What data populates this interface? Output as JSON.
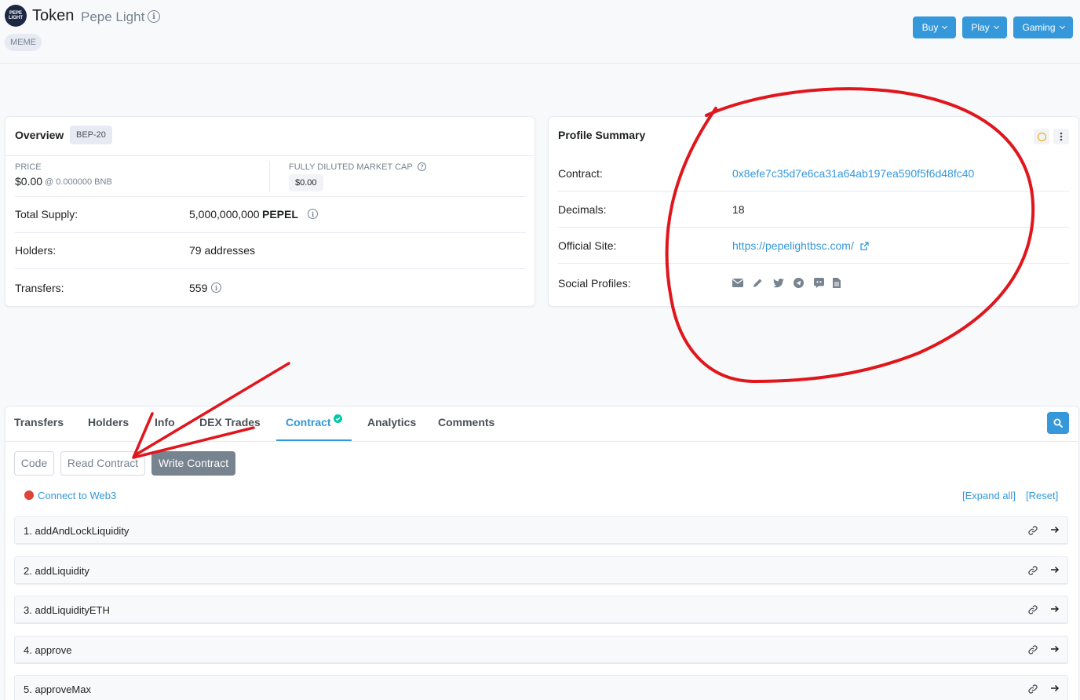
{
  "header": {
    "logo_text": "PEPE LIGHT",
    "title": "Token",
    "token_name": "Pepe Light",
    "tag": "MEME",
    "buttons": [
      {
        "label": "Buy"
      },
      {
        "label": "Play"
      },
      {
        "label": "Gaming"
      }
    ]
  },
  "overview": {
    "title": "Overview",
    "badge": "BEP-20",
    "price_label": "PRICE",
    "price_value": "$0.00",
    "price_bnb": "@ 0.000000 BNB",
    "mcap_label": "FULLY DILUTED MARKET CAP",
    "mcap_value": "$0.00",
    "total_supply_label": "Total Supply:",
    "total_supply_value": "5,000,000,000",
    "total_supply_symbol": "PEPEL",
    "holders_label": "Holders:",
    "holders_value": "79 addresses",
    "transfers_label": "Transfers:",
    "transfers_value": "559"
  },
  "profile": {
    "title": "Profile Summary",
    "contract_label": "Contract:",
    "contract_value": "0x8efe7c35d7e6ca31a64ab197ea590f5f6d48fc40",
    "decimals_label": "Decimals:",
    "decimals_value": "18",
    "site_label": "Official Site:",
    "site_value": "https://pepelightbsc.com/",
    "social_label": "Social Profiles:",
    "social_icons": [
      "email-icon",
      "pencil-icon",
      "twitter-icon",
      "telegram-icon",
      "discord-icon",
      "document-icon"
    ]
  },
  "tabs": [
    {
      "label": "Transfers"
    },
    {
      "label": "Holders"
    },
    {
      "label": "Info"
    },
    {
      "label": "DEX Trades"
    },
    {
      "label": "Contract",
      "active": true
    },
    {
      "label": "Analytics"
    },
    {
      "label": "Comments"
    }
  ],
  "contract_tabs": {
    "code": "Code",
    "read": "Read Contract",
    "write": "Write Contract"
  },
  "web3": {
    "connect_label": "Connect to Web3",
    "expand_all": "[Expand all]",
    "reset": "[Reset]"
  },
  "functions": [
    {
      "label": "1. addAndLockLiquidity"
    },
    {
      "label": "2. addLiquidity"
    },
    {
      "label": "3. addLiquidityETH"
    },
    {
      "label": "4. approve"
    },
    {
      "label": "5. approveMax"
    }
  ],
  "colors": {
    "accent": "#3498db",
    "annotation": "#e0161d",
    "verified": "#00c9a7",
    "web3_status": "#de4437"
  }
}
